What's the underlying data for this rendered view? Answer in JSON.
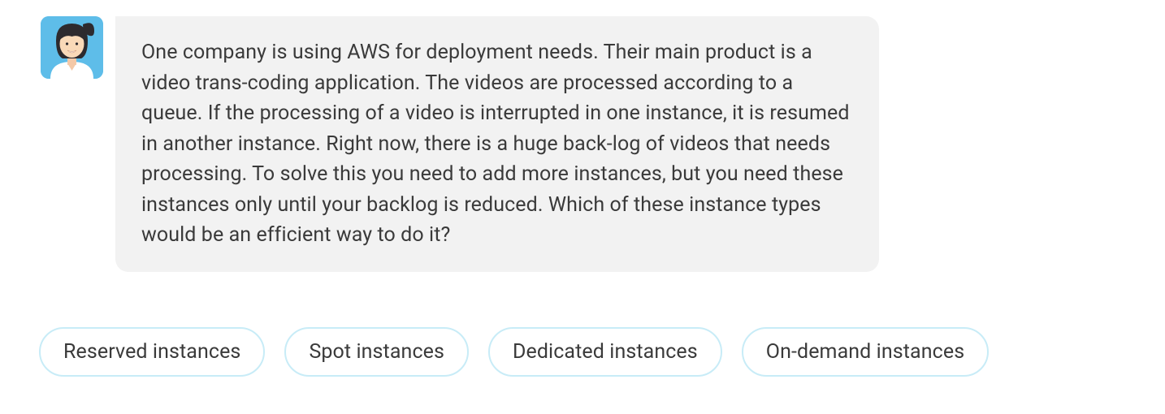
{
  "message": {
    "text": "One company is using AWS for deployment needs. Their main product is a video trans-coding application. The videos are processed according to a queue. If the processing of a video is interrupted in one instance, it is resumed in another instance. Right now, there is a huge back-log of videos that needs processing. To solve this you need to add more instances, but you need these instances only until your backlog is reduced. Which of these instance types would be an efficient way to do it?"
  },
  "options": [
    {
      "label": "Reserved instances"
    },
    {
      "label": "Spot instances"
    },
    {
      "label": "Dedicated instances"
    },
    {
      "label": "On-demand instances"
    }
  ],
  "colors": {
    "bubble_bg": "#f2f2f2",
    "option_border": "#c8ecf7",
    "text": "#3a3a3a",
    "avatar_bg": "#5EBDE9"
  }
}
